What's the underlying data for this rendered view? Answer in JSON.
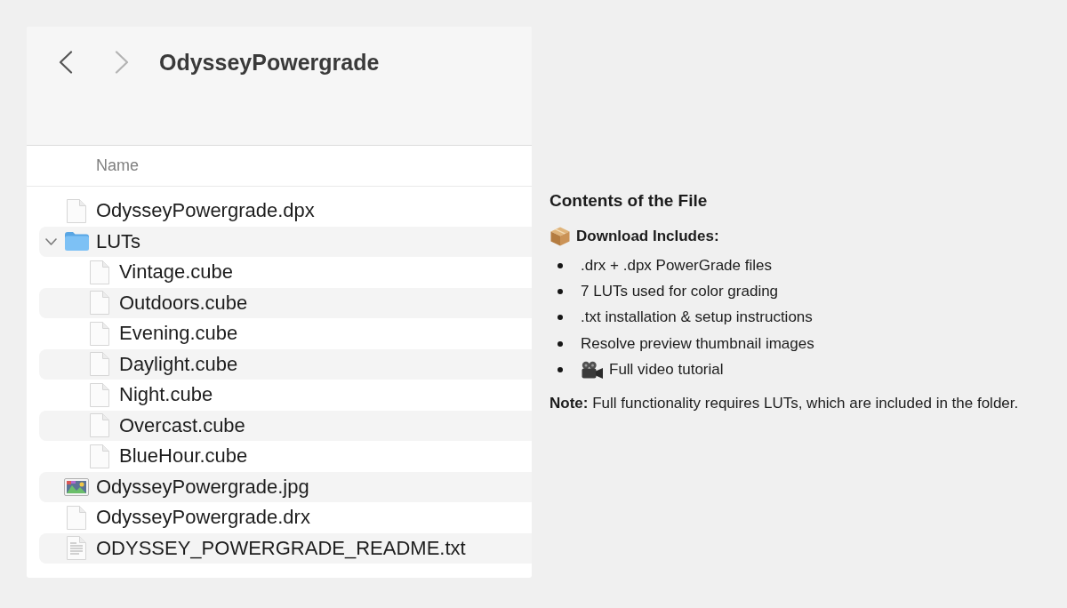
{
  "navigation": {
    "buttons": [
      {
        "kind": "back",
        "disabled": false
      },
      {
        "kind": "forward",
        "disabled": true
      }
    ],
    "title": "OdysseyPowergrade"
  },
  "file_list": {
    "columns": [
      "Name"
    ],
    "items": [
      {
        "name": "OdysseyPowergrade.dpx",
        "kind": "document"
      },
      {
        "name": "LUTs",
        "kind": "folder",
        "expanded": true,
        "children": [
          {
            "name": "Vintage.cube",
            "kind": "document"
          },
          {
            "name": "Outdoors.cube",
            "kind": "document"
          },
          {
            "name": "Evening.cube",
            "kind": "document"
          },
          {
            "name": "Daylight.cube",
            "kind": "document"
          },
          {
            "name": "Night.cube",
            "kind": "document"
          },
          {
            "name": "Overcast.cube",
            "kind": "document"
          },
          {
            "name": "BlueHour.cube",
            "kind": "document"
          }
        ]
      },
      {
        "name": "OdysseyPowergrade.jpg",
        "kind": "image"
      },
      {
        "name": "OdysseyPowergrade.drx",
        "kind": "document"
      },
      {
        "name": "ODYSSEY_POWERGRADE_README.txt",
        "kind": "text"
      }
    ]
  },
  "contents": {
    "title": "Contents of the File",
    "subtitle": "Download Includes:",
    "items": [
      {
        "text": ".drx + .dpx PowerGrade files",
        "kind": "plain"
      },
      {
        "text": "7 LUTs used for color grading",
        "kind": "plain"
      },
      {
        "text": ".txt installation & setup instructions",
        "kind": "plain"
      },
      {
        "text": "Resolve preview thumbnail images",
        "kind": "plain"
      },
      {
        "text": "Full video tutorial",
        "kind": "video"
      }
    ],
    "note": "**Note:** Full functionality requires LUTs, which are included in the folder."
  }
}
